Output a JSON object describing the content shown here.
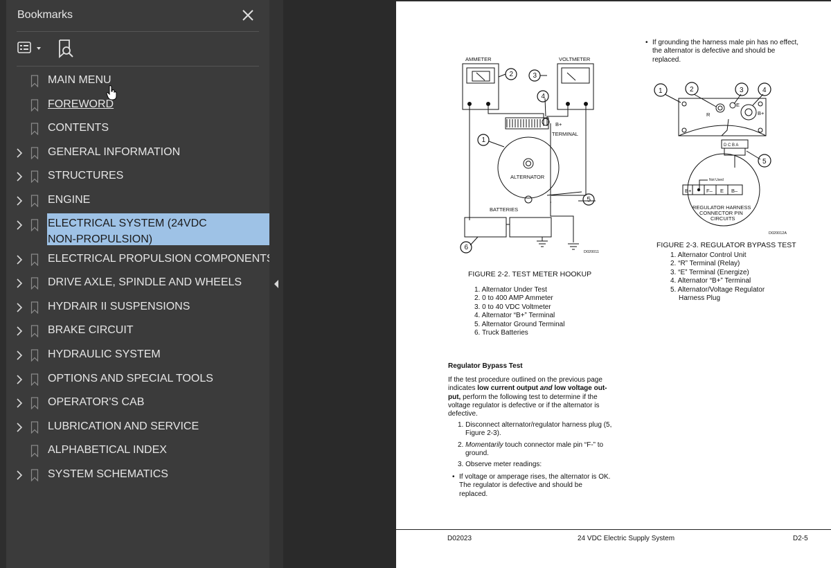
{
  "bookmarks_panel": {
    "title": "Bookmarks",
    "close_icon": "close-icon",
    "toolbar": {
      "menu_icon": "list-options-icon",
      "find_icon": "find-bookmark-icon"
    },
    "items": [
      {
        "label": "MAIN MENU",
        "expandable": false
      },
      {
        "label": "FOREWORD",
        "expandable": false,
        "underlined": true
      },
      {
        "label": "CONTENTS",
        "expandable": false
      },
      {
        "label": "GENERAL INFORMATION",
        "expandable": true
      },
      {
        "label": "STRUCTURES",
        "expandable": true
      },
      {
        "label": "ENGINE",
        "expandable": true
      },
      {
        "label_line1": "ELECTRICAL SYSTEM (24VDC",
        "label_line2": "NON-PROPULSION)",
        "expandable": true,
        "selected": true
      },
      {
        "label": "ELECTRICAL PROPULSION COMPONENTS",
        "expandable": true
      },
      {
        "label": "DRIVE AXLE, SPINDLE AND WHEELS",
        "expandable": true
      },
      {
        "label": "HYDRAIR II SUSPENSIONS",
        "expandable": true
      },
      {
        "label": "BRAKE CIRCUIT",
        "expandable": true
      },
      {
        "label": "HYDRAULIC SYSTEM",
        "expandable": true
      },
      {
        "label": "OPTIONS AND SPECIAL TOOLS",
        "expandable": true
      },
      {
        "label": "OPERATOR'S CAB",
        "expandable": true
      },
      {
        "label": "LUBRICATION AND SERVICE",
        "expandable": true
      },
      {
        "label": "ALPHABETICAL INDEX",
        "expandable": false
      },
      {
        "label": "SYSTEM SCHEMATICS",
        "expandable": true
      }
    ],
    "colors": {
      "panel_bg": "#3b3b3b",
      "selected_bg": "#9ec2e6",
      "text": "#e6e6e6"
    }
  },
  "document": {
    "fig22": {
      "labels": {
        "ammeter": "AMMETER",
        "voltmeter": "VOLTMETER",
        "bplus": "B+",
        "terminal": "TERMINAL",
        "alternator": "ALTERNATOR",
        "batteries": "BATTERIES",
        "code": "D020011",
        "n1": "1",
        "n2": "2",
        "n3": "3",
        "n4": "4",
        "n5": "5",
        "n6": "6"
      },
      "caption": "FIGURE 2-2. TEST METER HOOKUP",
      "list": [
        "1. Alternator Under Test",
        "2. 0 to 400 AMP Ammeter",
        "3. 0 to 40 VDC Voltmeter",
        "4. Alternator “B+” Terminal",
        "5. Alternator Ground Terminal",
        "6. Truck Batteries"
      ]
    },
    "fig23": {
      "labels": {
        "r": "R",
        "e": "E",
        "bplus": "B+",
        "dcba": "D  C  B  A",
        "not_used": "Not Used",
        "pins": [
          "B+",
          "•",
          "F–",
          "E",
          "B–"
        ],
        "harness1": "REGULATOR HARNESS",
        "harness2": "CONNECTOR PIN",
        "harness3": "CIRCUITS",
        "code": "D020012A",
        "n1": "1",
        "n2": "2",
        "n3": "3",
        "n4": "4",
        "n5": "5"
      },
      "caption": "FIGURE 2-3. REGULATOR BYPASS TEST",
      "list": [
        "1. Alternator Control Unit",
        "2. “R” Terminal (Relay)",
        "3. “E” Terminal (Energize)",
        "4. Alternator “B+” Terminal",
        "5. Alternator/Voltage Regulator",
        "Harness Plug"
      ]
    },
    "top_bullet": {
      "l1": "If grounding the harness male pin has no effect,",
      "l2": "the  alternator  is  defective  and  should  be",
      "l3": "replaced."
    },
    "regulator_test": {
      "heading": "Regulator Bypass Test",
      "p1": "If the test procedure outlined on the previous page",
      "p2a": "indicates ",
      "p2b": "low current output",
      "p2c": " and ",
      "p2d": "low voltage out-",
      "p3a": "put,",
      "p3b": " perform the following test to determine if the",
      "p4": "voltage regulator is defective or if the alternator is",
      "p5": "defective.",
      "s1a": "1. Disconnect alternator/regulator harness plug (5,",
      "s1b": "Figure 2-3).",
      "s2a": "2. ",
      "s2b": "Momentarily",
      "s2c": " touch connector male pin “F-” to",
      "s2d": "ground.",
      "s3": "3. Observe meter readings:",
      "b1": "If voltage or amperage rises, the alternator is OK.",
      "b2": "The   regulator   is   defective   and   should   be",
      "b3": "replaced."
    },
    "footer": {
      "left": "D02023",
      "center": "24 VDC Electric Supply System",
      "right": "D2-5"
    }
  }
}
